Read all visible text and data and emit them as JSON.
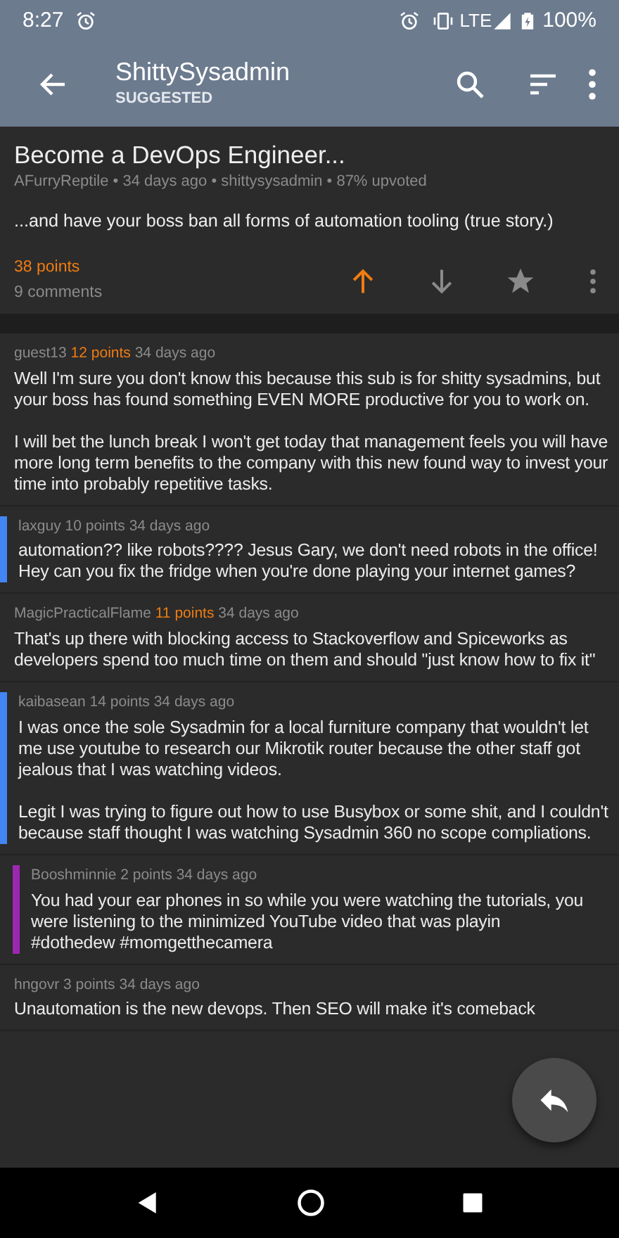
{
  "status_bar": {
    "time": "8:27",
    "network": "LTE",
    "battery": "100%"
  },
  "app_bar": {
    "title": "ShittySysadmin",
    "subtitle": "SUGGESTED"
  },
  "post": {
    "title": "Become a DevOps Engineer...",
    "meta": "AFurryReptile • 34 days ago • shittysysadmin • 87% upvoted",
    "body": "...and have your boss ban all forms of automation tooling (true story.)",
    "points": "38 points",
    "comments": "9 comments",
    "upvoted": true,
    "downvoted": false,
    "saved": false
  },
  "comments": [
    {
      "author": "guest13",
      "points": "12 points",
      "highlighted": true,
      "age": "34 days ago",
      "body": "Well I'm sure you don't know this because this sub is for shitty sysadmins, but your boss has found something EVEN MORE productive for you to work on.\n\nI will bet the lunch break I won't get today that management feels you will have more long term benefits to the company with this new found way to invest your time into probably repetitive tasks.",
      "children": [
        {
          "author": "laxguy",
          "points": "10 points",
          "highlighted": false,
          "age": "34 days ago",
          "color": "#4285f4",
          "body": "automation?? like robots???? Jesus Gary, we don't need robots in the office! Hey can you fix the fridge when you're done playing your internet games?"
        }
      ]
    },
    {
      "author": "MagicPracticalFlame",
      "points": "11 points",
      "highlighted": true,
      "age": "34 days ago",
      "body": "That's up there with blocking access to Stackoverflow and Spiceworks as developers spend too much time on them and should \"just know how to fix it\"",
      "children": [
        {
          "author": "kaibasean",
          "points": "14 points",
          "highlighted": false,
          "age": "34 days ago",
          "color": "#4285f4",
          "body": "I was once the sole Sysadmin for a local furniture company that wouldn't let me use youtube to research our Mikrotik router because the other staff got jealous that I was watching videos.\n\nLegit I was trying to figure out how to use Busybox or some shit, and I couldn't because staff thought I was watching Sysadmin 360 no scope compliations.",
          "children": [
            {
              "author": "Booshminnie",
              "points": "2 points",
              "highlighted": false,
              "age": "34 days ago",
              "color": "#9c27b0",
              "body": "You had your ear phones in so while you were watching the tutorials, you were listening to the minimized YouTube video that was playin\n#dothedew #momgetthecamera"
            }
          ]
        }
      ]
    },
    {
      "author": "hngovr",
      "points": "3 points",
      "highlighted": false,
      "age": "34 days ago",
      "body": "Unautomation is the new devops. Then SEO will make it's comeback"
    }
  ]
}
